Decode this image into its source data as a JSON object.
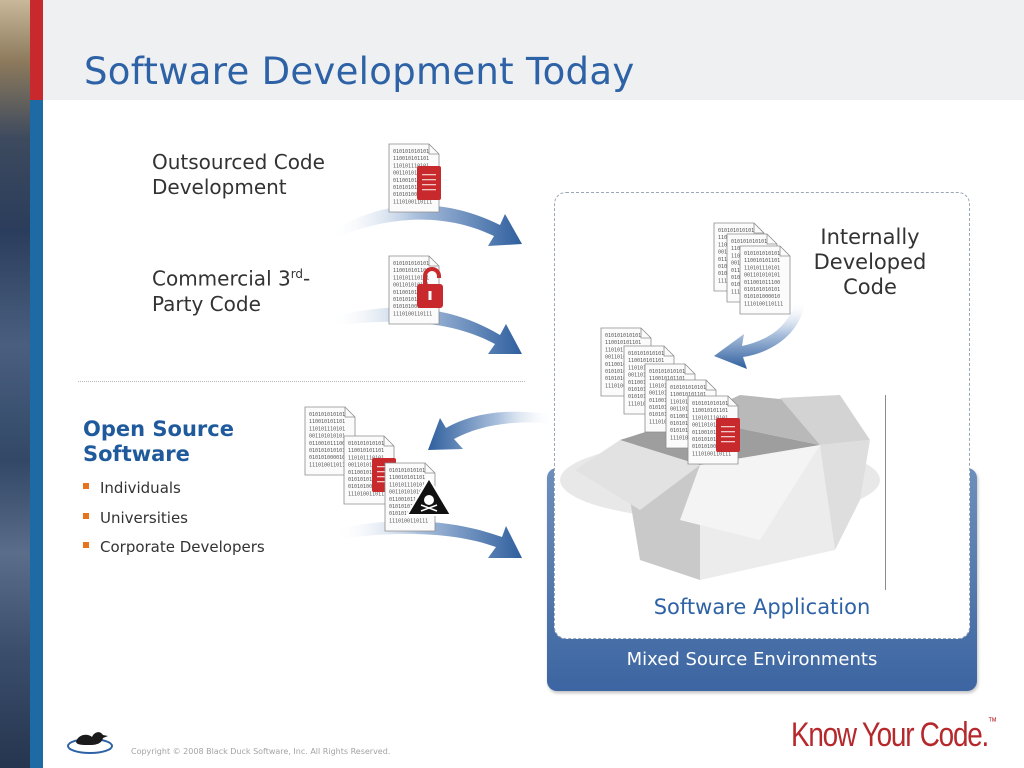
{
  "slide": {
    "title": "Software Development Today",
    "outsourced_label_line1": "Outsourced Code",
    "outsourced_label_line2": "Development",
    "commercial_label_prefix": "Commercial 3",
    "commercial_label_sup": "rd",
    "commercial_label_suffix": "-",
    "commercial_label_line2": "Party Code",
    "internal_label_line1": "Internally",
    "internal_label_line2": "Developed",
    "internal_label_line3": "Code",
    "open_source": {
      "heading_line1": "Open Source",
      "heading_line2": "Software",
      "bullets": [
        "Individuals",
        "Universities",
        "Corporate Developers"
      ]
    },
    "app_label": "Software Application",
    "environment_label": "Mixed Source Environments",
    "copyright": "Copyright © 2008 Black Duck Software, Inc.  All Rights Reserved.",
    "brand": "Know Your Code.",
    "brand_tm": "™",
    "binary_lines": [
      "010101010101",
      "110010101101",
      "110101110101",
      "001101010101",
      "011001011100",
      "010101010101",
      "010101000010",
      "1110100110111"
    ],
    "icons": {
      "outsourced_badge": "document-icon",
      "commercial_badge": "unlocked-padlock-icon",
      "open_source_badge": "skull-warning-icon",
      "application": "open-box-icon",
      "footer_logo": "duck-logo-icon"
    },
    "colors": {
      "title_blue": "#2e62a6",
      "accent_red": "#c8292c",
      "accent_blue_bar": "#1d6aa5",
      "bullet_orange": "#e8731e",
      "panel_blue": "#3c65a1",
      "arrow_blue": "#2f5f9e"
    }
  }
}
